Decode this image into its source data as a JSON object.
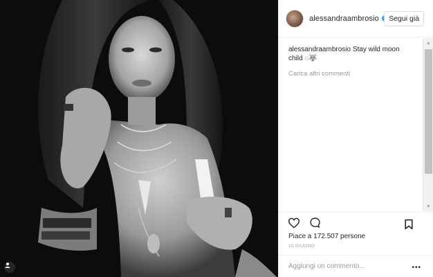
{
  "post": {
    "username": "alessandraambrosio",
    "follow_label": "Segui già",
    "caption_user": "alessandraambrosio",
    "caption_text": " Stay wild moon child ◌🐺",
    "load_more_label": "Carica altri commenti",
    "likes_label": "Piace a 172.507 persone",
    "date_label": "10 GIUGNO",
    "comment_placeholder": "Aggiungi un commento...",
    "more_label": "•••"
  },
  "icons": {
    "like": "heart-icon",
    "comment": "comment-icon",
    "save": "bookmark-icon",
    "verified": "verified-badge-icon",
    "scroll_up": "▲",
    "scroll_down": "▼"
  },
  "colors": {
    "verified": "#3897f0",
    "text": "#262626",
    "muted": "#999999"
  }
}
